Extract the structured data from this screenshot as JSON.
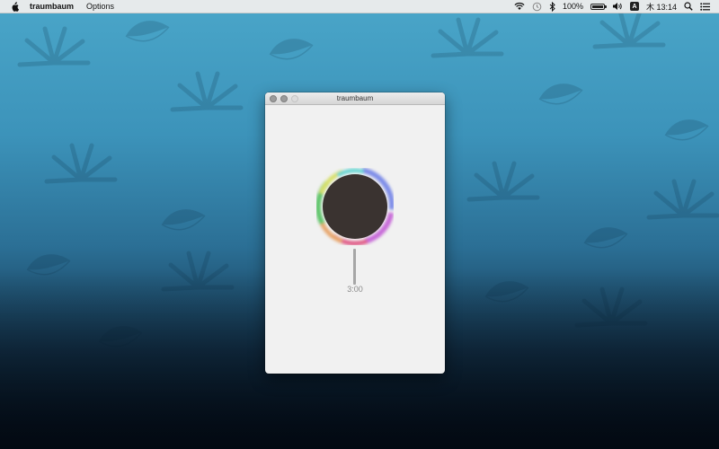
{
  "menubar": {
    "apple_icon": "apple-logo-icon",
    "app_name": "traumbaum",
    "menus": [
      "Options"
    ],
    "status": {
      "wifi_icon": "wifi-icon",
      "time_machine_icon": "time-machine-icon",
      "bluetooth_icon": "bluetooth-icon",
      "battery_percent": "100%",
      "battery_icon": "battery-icon",
      "battery_level": 1.0,
      "volume_icon": "volume-icon",
      "input_source": "A",
      "clock": "木 13:14",
      "spotlight_icon": "spotlight-search-icon",
      "notification_icon": "notification-center-icon"
    }
  },
  "window": {
    "title": "traumbaum",
    "timer_label": "3:00",
    "dial_color": "#3a3330",
    "needle_color": "#a6a6a6"
  },
  "desktop": {
    "wallpaper": "tropical leaves, blue gradient"
  }
}
